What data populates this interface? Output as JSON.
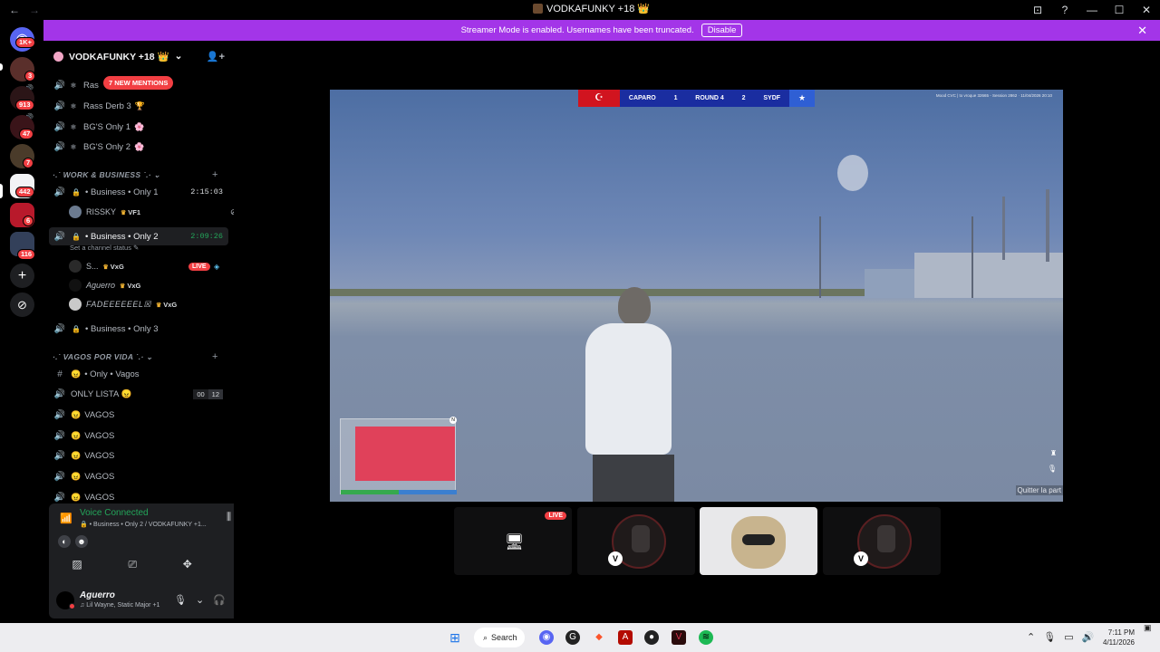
{
  "window": {
    "title": "VODKAFUNKY +18 👑",
    "back": "←",
    "forward": "→",
    "controls": [
      "⊡",
      "?",
      "—",
      "☐",
      "✕"
    ]
  },
  "banner": {
    "message": "Streamer Mode is enabled. Usernames have been truncated.",
    "button": "Disable",
    "close": "✕"
  },
  "rail": {
    "badges": [
      "1K+",
      "3",
      "913",
      "47",
      "7",
      "442",
      "6",
      "116"
    ],
    "add": "+",
    "explore": "⊘"
  },
  "guild": {
    "name": "VODKAFUNKY +18 👑",
    "mentions_pill": "7 NEW MENTIONS",
    "channels_top": [
      {
        "name": "Ras",
        "emoji": ""
      },
      {
        "name": "Rass Derb 3",
        "emoji": "🏆"
      },
      {
        "name": "BG'S Only 1",
        "emoji": "🌸"
      },
      {
        "name": "BG'S Only 2",
        "emoji": "🌸"
      }
    ],
    "category_work": "·.˙ WORK & BUSINESS ˙.·",
    "business1": {
      "name": "• Business • Only 1",
      "time": "2:15:03"
    },
    "business1_user": {
      "name": "RISSKY",
      "tag": "VF1"
    },
    "business2": {
      "name": "• Business • Only 2",
      "time": "2:09:26"
    },
    "business2_status": "Set a channel status ✎",
    "business2_users": [
      {
        "name": "S...",
        "tag": "VxG",
        "live": "LIVE"
      },
      {
        "name": "Aguerro",
        "tag": "VxG"
      },
      {
        "name": "FADEEEEEEL☒",
        "tag": "VxG"
      }
    ],
    "business3": {
      "name": "• Business • Only 3"
    },
    "category_vagos": "·.˙ VAGOS POR VIDA ˙.·",
    "vagos_text": "• Only • Vagos",
    "only_lista": {
      "name": "ONLY LISTA 😠",
      "count_a": "00",
      "count_b": "12"
    },
    "vagos": [
      "VAGOS",
      "VAGOS",
      "VAGOS",
      "VAGOS",
      "VAGOS"
    ]
  },
  "voice": {
    "status": "Voice Connected",
    "channel": "🔒 • Business • Only 2 / VODKAFUNKY +1...",
    "user": "Aguerro",
    "activity": "♫ Lil Wayne, Static Major +1"
  },
  "stream": {
    "hud": {
      "team_a": "CAPARO",
      "score_a": "1",
      "round": "ROUND 4",
      "score_b": "2",
      "team_b": "SYDF",
      "info": "Mood CVC | to vroque 32665 - Session 2862 · 11/04/2026 20:10",
      "quit": "Quitter la part"
    },
    "tiles": [
      {
        "type": "screen",
        "live": "LIVE"
      },
      {
        "type": "avatar"
      },
      {
        "type": "avatar-active"
      },
      {
        "type": "avatar"
      }
    ]
  },
  "taskbar": {
    "search": "Search",
    "time": "7:11 PM",
    "date": "4/11/2026"
  }
}
